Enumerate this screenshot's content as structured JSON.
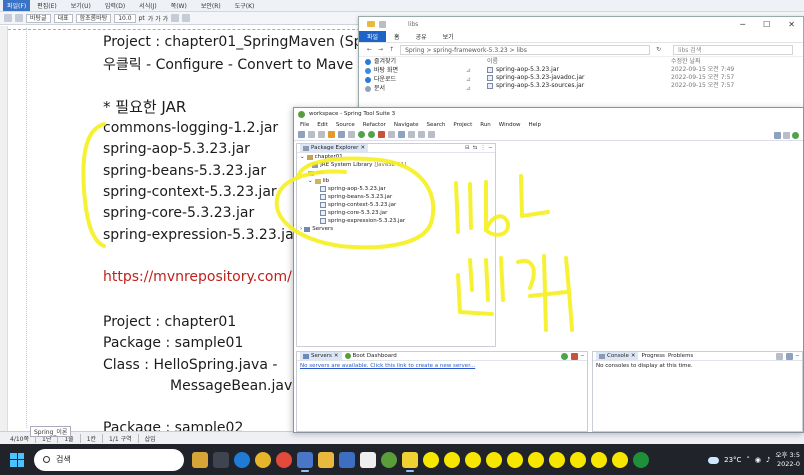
{
  "hwp": {
    "menu": [
      "파일(F)",
      "편집(E)",
      "보기(U)",
      "입력(D)",
      "서식(J)",
      "쪽(W)",
      "보안(R)",
      "도구(K)"
    ],
    "toolbar": {
      "style": "바탕글",
      "font_lang": "대표",
      "font": "함초롬바탕",
      "size": "10.0",
      "unit": "pt",
      "bold_italic": "가 가 가"
    },
    "doc_lines": [
      "Project : chapter01_SpringMaven (Spring",
      "우클릭 - Configure - Convert to Mave",
      "* 필요한 JAR",
      "commons-logging-1.2.jar",
      "spring-aop-5.3.23.jar",
      "spring-beans-5.3.23.jar",
      "spring-context-5.3.23.jar",
      "spring-core-5.3.23.jar",
      "spring-expression-5.3.23.jar",
      "https://mvnrepository.com/",
      "Project : chapter01",
      "Package : sample01",
      "Class     : HelloSpring.java -",
      "MessageBean.java",
      "Package     : sample02"
    ],
    "tab_label": "Spring_이론",
    "status": [
      "4/10쪽",
      "1단",
      "1줄",
      "1칸",
      "1/1 구역",
      "삽입"
    ]
  },
  "explorer": {
    "title": "libs",
    "ribbon": [
      "파일",
      "홈",
      "공유",
      "보기"
    ],
    "breadcrumb": "Spring  >  spring-framework-5.3.23  >  libs",
    "search_placeholder": "libs 검색",
    "nav_items": [
      "즐겨찾기",
      "바탕 화면",
      "다운로드",
      "문서"
    ],
    "col_name": "이름",
    "col_date": "수정한 날짜",
    "files": [
      {
        "name": "spring-aop-5.3.23.jar",
        "date": "2022-09-15 오전 7:49"
      },
      {
        "name": "spring-aop-5.3.23-javadoc.jar",
        "date": "2022-09-15 오전 7:57"
      },
      {
        "name": "spring-aop-5.3.23-sources.jar",
        "date": "2022-09-15 오전 7:57"
      }
    ]
  },
  "sts": {
    "title": "workspace - Spring Tool Suite 3",
    "menu": [
      "File",
      "Edit",
      "Source",
      "Refactor",
      "Navigate",
      "Search",
      "Project",
      "Run",
      "Window",
      "Help"
    ],
    "package_explorer": "Package Explorer",
    "tree": {
      "project": "chapter01",
      "jre": "JRE System Library",
      "jre_version": "[JavaSE-11]",
      "src": "src",
      "lib": "lib",
      "jars": [
        "spring-aop-5.3.23.jar",
        "spring-beans-5.3.23.jar",
        "spring-context-5.3.23.jar",
        "spring-core-5.3.23.jar",
        "spring-expression-5.3.23.jar"
      ],
      "servers": "Servers"
    },
    "servers_tab": "Servers",
    "boot_tab": "Boot Dashboard",
    "servers_msg": "No servers are available. Click this link to create a new server...",
    "console_tab": "Console",
    "progress_tab": "Progress",
    "problems_tab": "Problems",
    "console_msg": "No consoles to display at this time."
  },
  "taskbar": {
    "search_label": "검색",
    "temperature": "23°C",
    "time": "오후 3:5",
    "date": "2022-0"
  },
  "annotation_colors": {
    "highlighter": "#f6f01e"
  },
  "colors": {
    "link": "#c0211a",
    "explorer_file_tab": "#1e64c8",
    "taskbar": "#20232a"
  }
}
